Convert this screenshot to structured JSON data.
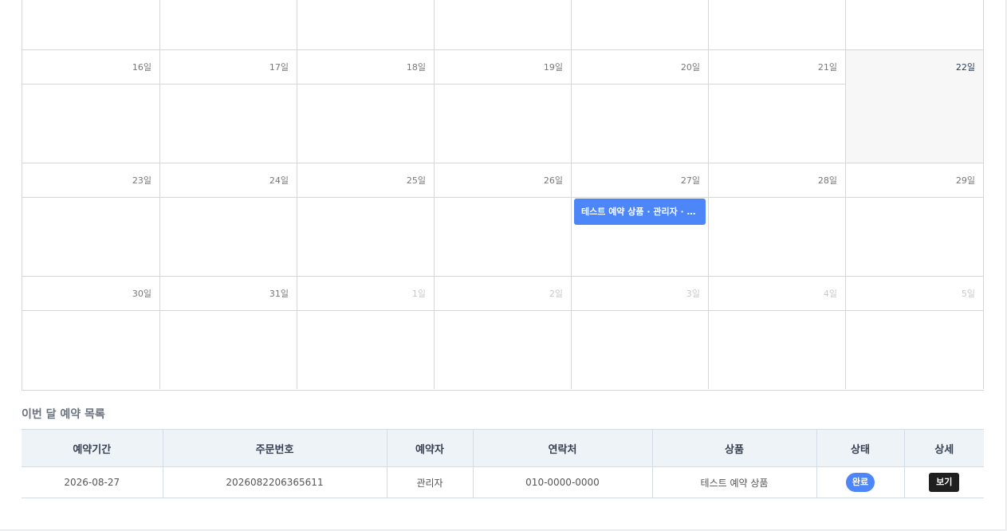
{
  "calendar": {
    "top_partial_row": [
      "",
      "",
      "",
      "",
      "",
      "",
      ""
    ],
    "weeks": [
      {
        "days": [
          {
            "label": "16일",
            "kind": "current"
          },
          {
            "label": "17일",
            "kind": "current"
          },
          {
            "label": "18일",
            "kind": "current"
          },
          {
            "label": "19일",
            "kind": "current"
          },
          {
            "label": "20일",
            "kind": "current"
          },
          {
            "label": "21일",
            "kind": "current"
          },
          {
            "label": "22일",
            "kind": "today"
          }
        ],
        "events": []
      },
      {
        "days": [
          {
            "label": "23일",
            "kind": "current"
          },
          {
            "label": "24일",
            "kind": "current"
          },
          {
            "label": "25일",
            "kind": "current"
          },
          {
            "label": "26일",
            "kind": "current"
          },
          {
            "label": "27일",
            "kind": "current"
          },
          {
            "label": "28일",
            "kind": "current"
          },
          {
            "label": "29일",
            "kind": "current"
          }
        ],
        "events": [
          {
            "day_index": 4,
            "text": "테스트 예약 상품 · 관리자 · 0..."
          }
        ]
      },
      {
        "days": [
          {
            "label": "30일",
            "kind": "current"
          },
          {
            "label": "31일",
            "kind": "current"
          },
          {
            "label": "1일",
            "kind": "other"
          },
          {
            "label": "2일",
            "kind": "other"
          },
          {
            "label": "3일",
            "kind": "other"
          },
          {
            "label": "4일",
            "kind": "other"
          },
          {
            "label": "5일",
            "kind": "other"
          }
        ],
        "events": []
      }
    ]
  },
  "reservations": {
    "title": "이번 달 예약 목록",
    "columns": [
      "예약기간",
      "주문번호",
      "예약자",
      "연락처",
      "상품",
      "상태",
      "상세"
    ],
    "rows": [
      {
        "period": "2026-08-27",
        "order_no": "2026082206365611",
        "name": "관리자",
        "phone": "010-0000-0000",
        "product": "테스트 예약 상품",
        "status": "완료",
        "detail": "보기"
      }
    ]
  },
  "colors": {
    "event": "#4c86f9",
    "status_badge": "#4c86f9",
    "view_button": "#1f1f1f",
    "header_bg": "#eef3f8"
  }
}
